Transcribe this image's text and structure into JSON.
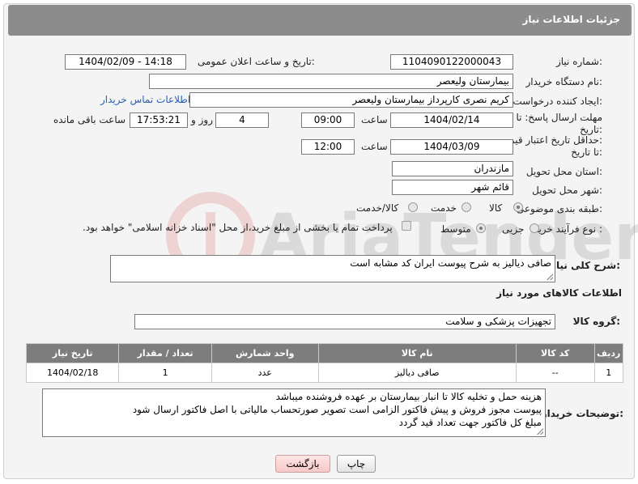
{
  "header": {
    "title": "جزئیات اطلاعات نیاز"
  },
  "form": {
    "need_number_label": "شماره نیاز:",
    "need_number": "1104090122000043",
    "announce_label": "تاریخ و ساعت اعلان عمومی:",
    "announce_value": "1404/02/09 - 14:18",
    "buyer_org_label": "نام دستگاه خریدار:",
    "buyer_org": "بیمارستان ولیعصر",
    "creator_label": "ایجاد کننده درخواست:",
    "creator": "کریم نصری کارپرداز بیمارستان ولیعصر",
    "contact_link": "اطلاعات تماس خریدار",
    "reply_deadline_label_1": "مهلت ارسال پاسخ: تا",
    "reply_deadline_label_2": "تاریخ:",
    "reply_date": "1404/02/14",
    "time_label": "ساعت",
    "reply_time": "09:00",
    "days": "4",
    "days_label": "روز و",
    "remaining_time": "17:53:21",
    "remaining_label": "ساعت باقی مانده",
    "price_validity_label_1": "حداقل تاریخ اعتبار قیمت:",
    "price_validity_label_2": "تا تاریخ:",
    "price_date": "1404/03/09",
    "price_time": "12:00",
    "province_label": "استان محل تحویل:",
    "province": "مازندران",
    "city_label": "شهر محل تحویل:",
    "city": "قائم شهر",
    "category_label": "طبقه بندی موضوعی:",
    "category_options": [
      "کالا",
      "خدمت",
      "کالا/خدمت"
    ],
    "process_label": "نوع فرآیند خرید :",
    "process_options": [
      "جزیی",
      "متوسط"
    ],
    "payment_note": "پرداخت تمام یا بخشی از مبلغ خرید،از محل \"اسناد خزانه اسلامی\" خواهد بود."
  },
  "description": {
    "label": "شرح کلی نیاز:",
    "text": "صافی دیالیز به شرح پیوست   ایران کد مشابه است"
  },
  "goods": {
    "section_title": "اطلاعات کالاهای مورد نیاز",
    "group_label": "گروه کالا:",
    "group_value": "تجهیزات پزشکی و سلامت",
    "columns": [
      "ردیف",
      "کد کالا",
      "نام کالا",
      "واحد شمارش",
      "تعداد / مقدار",
      "تاریخ نیاز"
    ],
    "rows": [
      [
        "1",
        "--",
        "صافی دیالیز",
        "عدد",
        "1",
        "1404/02/18"
      ]
    ]
  },
  "buyer_notes": {
    "label": "توضیحات خریدار:",
    "lines": [
      "هزینه حمل و تخلیه کالا تا انبار بیمارستان بر عهده فروشنده میباشد",
      "پیوست مجوز فروش و پیش فاکتور الزامی است  تصویر صورتحساب مالیاتی با اصل فاکتور ارسال شود",
      "مبلغ کل فاکتور جهت تعداد قید گردد"
    ]
  },
  "buttons": {
    "print": "چاپ",
    "back": "بازگشت"
  },
  "watermark_text": "AriaTender.neT",
  "colors": {
    "header_bg": "#8c8c8c",
    "table_header_bg": "#7d7d7d",
    "link": "#2a5db0",
    "back_button": "#f5c8c8"
  }
}
